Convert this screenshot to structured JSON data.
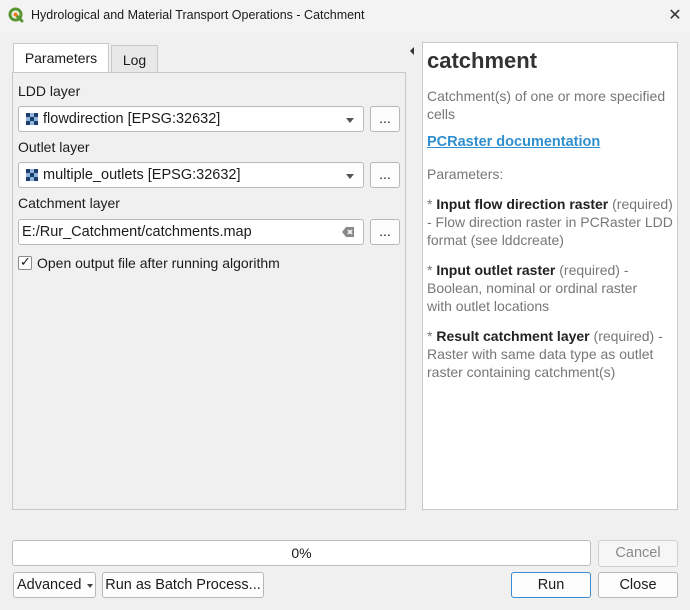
{
  "window": {
    "title": "Hydrological and Material Transport Operations - Catchment",
    "close_glyph": "✕"
  },
  "tabs": [
    {
      "label": "Parameters",
      "active": true
    },
    {
      "label": "Log",
      "active": false
    }
  ],
  "params": {
    "ldd_label": "LDD layer",
    "ldd_value": "flowdirection [EPSG:32632]",
    "outlet_label": "Outlet layer",
    "outlet_value": "multiple_outlets [EPSG:32632]",
    "catchment_label": "Catchment layer",
    "catchment_value": "E:/Rur_Catchment/catchments.map",
    "browse_label": "...",
    "open_output_label": "Open output file after running algorithm",
    "open_output_checked": true
  },
  "help": {
    "title": "catchment",
    "intro": "Catchment(s) of one or more specified cells",
    "doc_link": "PCRaster documentation",
    "params_heading": "Parameters:",
    "bullet": "*",
    "p1_name": "Input flow direction raster",
    "p1_desc": "(required) - Flow direction raster in PCRaster LDD format (see lddcreate)",
    "p2_name": "Input outlet raster",
    "p2_desc": "(required) - Boolean, nominal or ordinal raster with outlet locations",
    "p3_name": "Result catchment layer",
    "p3_desc": "(required) - Raster with same data type as outlet raster containing catchment(s)"
  },
  "footer": {
    "progress_text": "0%",
    "progress_value": 0,
    "cancel_label": "Cancel",
    "advanced_label": "Advanced",
    "batch_label": "Run as Batch Process...",
    "run_label": "Run",
    "close_label": "Close"
  },
  "colors": {
    "link": "#2f8fce",
    "primary_border": "#3c8ad2",
    "logo": "#589632"
  },
  "icons": {
    "app": "qgis-logo-icon",
    "raster": "raster-layer-icon",
    "clear": "clear-text-icon",
    "collapse": "collapse-arrow-icon"
  }
}
